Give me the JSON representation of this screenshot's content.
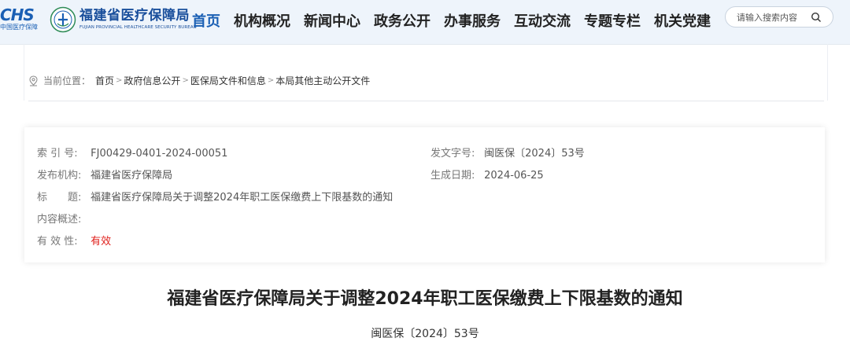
{
  "header": {
    "logo_text": "CHS",
    "logo_subtext": "中国医疗保障",
    "brand_name": "福建省医疗保障局",
    "brand_en": "FUJIAN PROVINCIAL HEALTHCARE SECURITY BUREAU",
    "nav": [
      {
        "label": "首页",
        "active": true
      },
      {
        "label": "机构概况",
        "active": false
      },
      {
        "label": "新闻中心",
        "active": false
      },
      {
        "label": "政务公开",
        "active": false
      },
      {
        "label": "办事服务",
        "active": false
      },
      {
        "label": "互动交流",
        "active": false
      },
      {
        "label": "专题专栏",
        "active": false
      },
      {
        "label": "机关党建",
        "active": false
      }
    ],
    "search_placeholder": "请输入搜索内容"
  },
  "breadcrumb": {
    "label": "当前位置：",
    "items": [
      "首页",
      "政府信息公开",
      "医保局文件和信息",
      "本局其他主动公开文件"
    ],
    "separator": ">"
  },
  "meta": {
    "index_label": "索 引 号:",
    "index_value": "FJ00429-0401-2024-00051",
    "doc_no_label": "发文字号:",
    "doc_no_value": "闽医保〔2024〕53号",
    "publisher_label": "发布机构:",
    "publisher_value": "福建省医疗保障局",
    "date_label": "生成日期:",
    "date_value": "2024-06-25",
    "title_label": "标　　题:",
    "title_value": "福建省医疗保障局关于调整2024年职工医保缴费上下限基数的通知",
    "summary_label": "内容概述:",
    "summary_value": "",
    "validity_label": "有 效 性:",
    "validity_value": "有效"
  },
  "document": {
    "title": "福建省医疗保障局关于调整2024年职工医保缴费上下限基数的通知",
    "number": "闽医保〔2024〕53号"
  },
  "colors": {
    "brand_blue": "#1a5fb4",
    "header_bg": "#eef4fb",
    "valid_red": "#e0201c"
  }
}
